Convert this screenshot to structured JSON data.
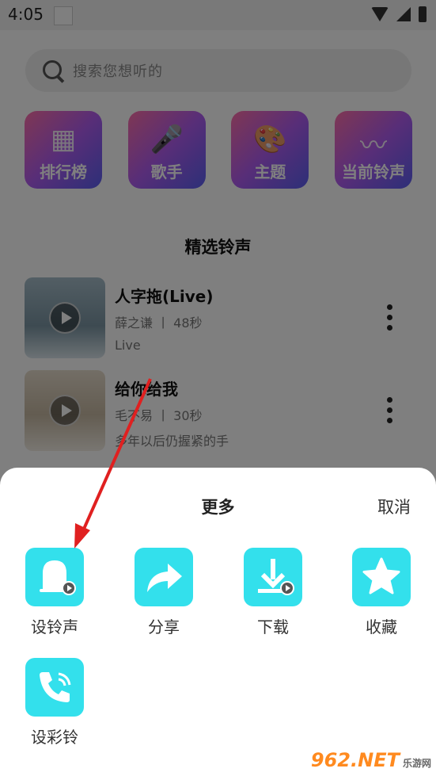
{
  "status": {
    "time": "4:05"
  },
  "search": {
    "placeholder": "搜索您想听的"
  },
  "categories": [
    {
      "label": "排行榜",
      "glyph": "▦"
    },
    {
      "label": "歌手",
      "glyph": "🎤"
    },
    {
      "label": "主题",
      "glyph": "🎨"
    },
    {
      "label": "当前铃声",
      "glyph": "〰"
    }
  ],
  "section": {
    "title": "精选铃声"
  },
  "songs": [
    {
      "title": "人字拖(Live)",
      "meta": "薛之谦 丨 48秒",
      "sub": "Live"
    },
    {
      "title": "给你给我",
      "meta": "毛不易 丨 30秒",
      "sub": "多年以后仍握紧的手"
    }
  ],
  "sheet": {
    "title": "更多",
    "cancel": "取消",
    "actions": [
      {
        "label": "设铃声",
        "icon": "bell-icon"
      },
      {
        "label": "分享",
        "icon": "share-icon"
      },
      {
        "label": "下载",
        "icon": "download-icon"
      },
      {
        "label": "收藏",
        "icon": "star-icon"
      },
      {
        "label": "设彩铃",
        "icon": "phone-icon"
      }
    ]
  },
  "watermark": {
    "text": "962.NET",
    "sub": "乐游网"
  },
  "colors": {
    "action_bg": "#33e0ec",
    "arrow": "#e02020"
  }
}
